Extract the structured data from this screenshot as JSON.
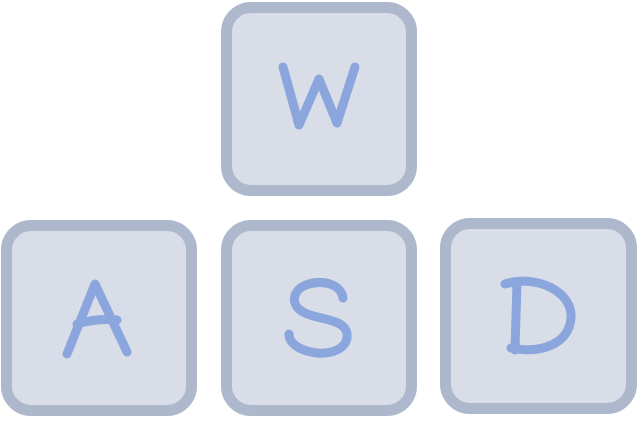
{
  "keys": [
    {
      "id": "w",
      "label": "W"
    },
    {
      "id": "a",
      "label": "A"
    },
    {
      "id": "s",
      "label": "S"
    },
    {
      "id": "d",
      "label": "D"
    }
  ],
  "colors": {
    "key_fill": "#d8dde8",
    "key_border": "#adb8cc",
    "letter": "#8aa6dd",
    "background": "#ffffff"
  }
}
